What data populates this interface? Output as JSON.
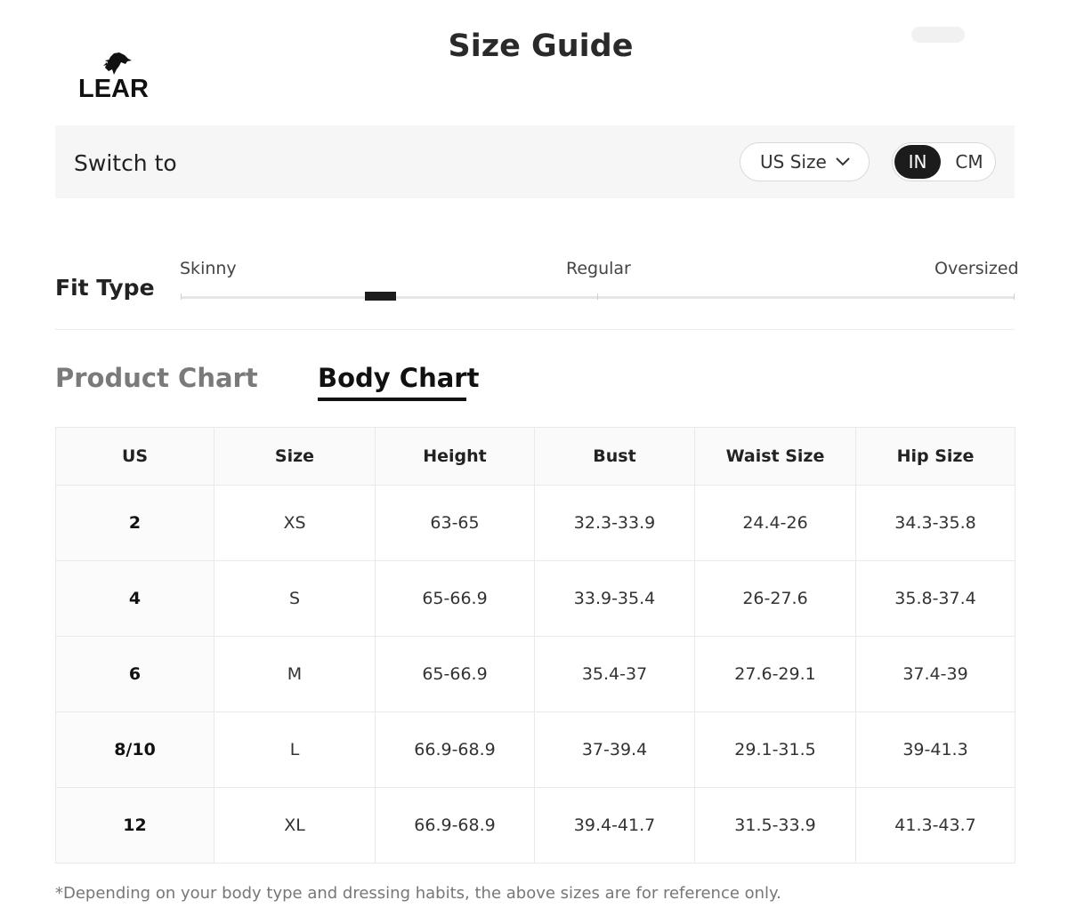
{
  "header": {
    "logo_text": "LEAR",
    "title": "Size Guide"
  },
  "switch_bar": {
    "label": "Switch to",
    "size_system": "US Size",
    "units": [
      "IN",
      "CM"
    ],
    "selected_unit": "IN"
  },
  "fit_type": {
    "label": "Fit Type",
    "marks": [
      "Skinny",
      "Regular",
      "Oversized"
    ],
    "value_fraction": 0.24
  },
  "tabs": {
    "product_chart": "Product Chart",
    "body_chart": "Body Chart",
    "active": "Body Chart"
  },
  "table": {
    "headers": [
      "US",
      "Size",
      "Height",
      "Bust",
      "Waist Size",
      "Hip Size"
    ],
    "rows": [
      [
        "2",
        "XS",
        "63-65",
        "32.3-33.9",
        "24.4-26",
        "34.3-35.8"
      ],
      [
        "4",
        "S",
        "65-66.9",
        "33.9-35.4",
        "26-27.6",
        "35.8-37.4"
      ],
      [
        "6",
        "M",
        "65-66.9",
        "35.4-37",
        "27.6-29.1",
        "37.4-39"
      ],
      [
        "8/10",
        "L",
        "66.9-68.9",
        "37-39.4",
        "29.1-31.5",
        "39-41.3"
      ],
      [
        "12",
        "XL",
        "66.9-68.9",
        "39.4-41.7",
        "31.5-33.9",
        "41.3-43.7"
      ]
    ]
  },
  "footnote": "*Depending on your body type and dressing habits, the above sizes are for reference only.",
  "colors": {
    "accent": "#1c1c1c",
    "bar_background": "#f6f6f6",
    "inactive_tab": "#7a7a7a"
  }
}
